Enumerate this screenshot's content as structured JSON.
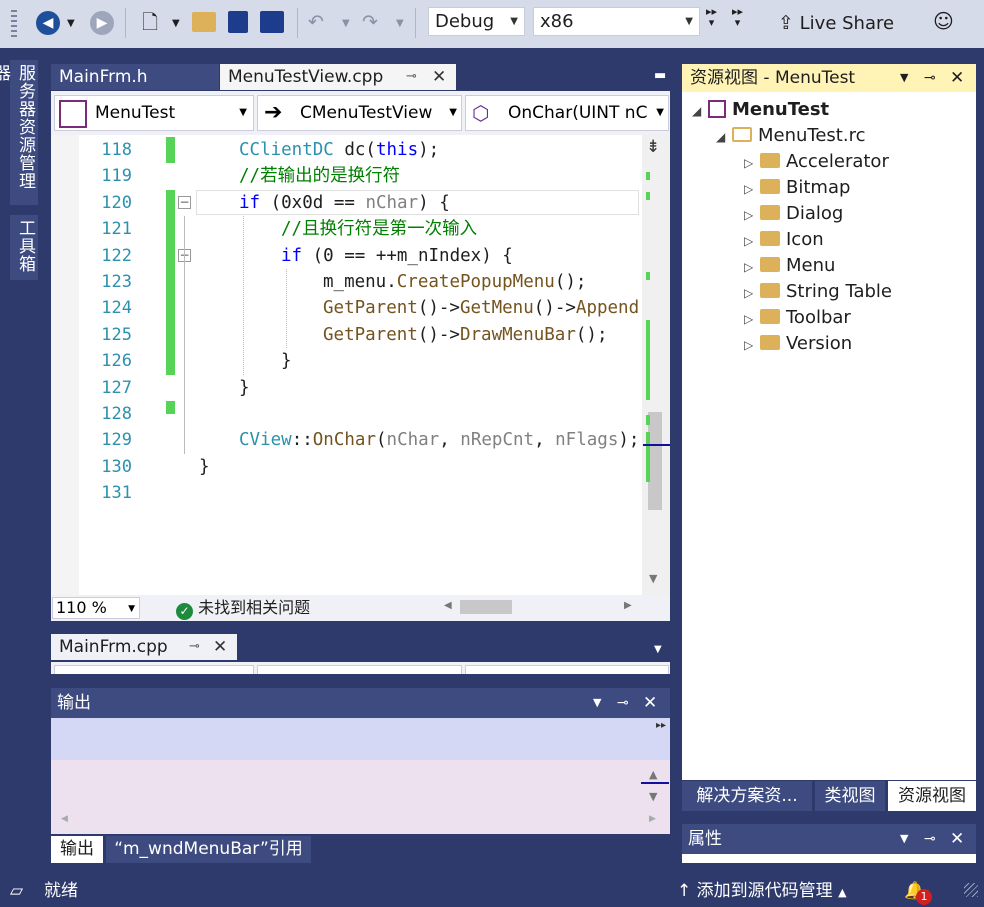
{
  "toolbar": {
    "config": "Debug",
    "platform": "x86",
    "live_share": "Live Share"
  },
  "left_tabs": [
    "服务器资源管理器",
    "工具箱"
  ],
  "editor": {
    "tabs": [
      {
        "label": "MainFrm.h",
        "active": false
      },
      {
        "label": "MenuTestView.cpp",
        "active": true
      }
    ],
    "nav": {
      "project": "MenuTest",
      "class": "CMenuTestView",
      "member": "OnChar(UINT nC"
    },
    "lines": [
      {
        "num": "118",
        "indent": 1,
        "tokens": [
          {
            "t": "CClientDC",
            "c": "ty"
          },
          {
            "t": " dc(",
            "c": ""
          },
          {
            "t": "this",
            "c": "kw"
          },
          {
            "t": ");",
            "c": ""
          }
        ]
      },
      {
        "num": "119",
        "indent": 1,
        "tokens": [
          {
            "t": "//若输出的是换行符",
            "c": "cm"
          }
        ]
      },
      {
        "num": "120",
        "indent": 1,
        "tokens": [
          {
            "t": "if",
            "c": "kw"
          },
          {
            "t": " (0x0d == ",
            "c": ""
          },
          {
            "t": "nChar",
            "c": "pr"
          },
          {
            "t": ") {",
            "c": ""
          }
        ]
      },
      {
        "num": "121",
        "indent": 2,
        "tokens": [
          {
            "t": "//且换行符是第一次输入",
            "c": "cm"
          }
        ]
      },
      {
        "num": "122",
        "indent": 2,
        "tokens": [
          {
            "t": "if",
            "c": "kw"
          },
          {
            "t": " (0 == ++m_nIndex) {",
            "c": ""
          }
        ]
      },
      {
        "num": "123",
        "indent": 3,
        "tokens": [
          {
            "t": "m_menu.",
            "c": ""
          },
          {
            "t": "CreatePopupMenu",
            "c": "fn"
          },
          {
            "t": "();",
            "c": ""
          }
        ]
      },
      {
        "num": "124",
        "indent": 3,
        "tokens": [
          {
            "t": "GetParent",
            "c": "fn"
          },
          {
            "t": "()->",
            "c": ""
          },
          {
            "t": "GetMenu",
            "c": "fn"
          },
          {
            "t": "()->",
            "c": ""
          },
          {
            "t": "Append",
            "c": "fn"
          }
        ]
      },
      {
        "num": "125",
        "indent": 3,
        "tokens": [
          {
            "t": "GetParent",
            "c": "fn"
          },
          {
            "t": "()->",
            "c": ""
          },
          {
            "t": "DrawMenuBar",
            "c": "fn"
          },
          {
            "t": "();",
            "c": ""
          }
        ]
      },
      {
        "num": "126",
        "indent": 2,
        "tokens": [
          {
            "t": "}",
            "c": ""
          }
        ]
      },
      {
        "num": "127",
        "indent": 1,
        "tokens": [
          {
            "t": "}",
            "c": ""
          }
        ]
      },
      {
        "num": "128",
        "indent": 1,
        "tokens": []
      },
      {
        "num": "129",
        "indent": 1,
        "tokens": [
          {
            "t": "CView",
            "c": "ty"
          },
          {
            "t": "::",
            "c": ""
          },
          {
            "t": "OnChar",
            "c": "fn"
          },
          {
            "t": "(",
            "c": ""
          },
          {
            "t": "nChar",
            "c": "pr"
          },
          {
            "t": ", ",
            "c": ""
          },
          {
            "t": "nRepCnt",
            "c": "pr"
          },
          {
            "t": ", ",
            "c": ""
          },
          {
            "t": "nFlags",
            "c": "pr"
          },
          {
            "t": ");",
            "c": ""
          }
        ]
      },
      {
        "num": "130",
        "indent": 0,
        "tokens": [
          {
            "t": "}",
            "c": ""
          }
        ]
      },
      {
        "num": "131",
        "indent": 0,
        "tokens": []
      }
    ],
    "zoom": "110 %",
    "issues": "未找到相关问题"
  },
  "second_editor": {
    "tab": "MainFrm.cpp"
  },
  "output": {
    "title": "输出",
    "tabs": [
      "输出",
      "“m_wndMenuBar”引用"
    ]
  },
  "resource_view": {
    "title": "资源视图 - MenuTest",
    "root": "MenuTest",
    "rc": "MenuTest.rc",
    "folders": [
      "Accelerator",
      "Bitmap",
      "Dialog",
      "Icon",
      "Menu",
      "String Table",
      "Toolbar",
      "Version"
    ],
    "bottom_tabs": [
      "解决方案资...",
      "类视图",
      "资源视图"
    ]
  },
  "properties": {
    "title": "属性"
  },
  "status": {
    "ready": "就绪",
    "source_control": "添加到源代码管理",
    "notifications": "1"
  }
}
